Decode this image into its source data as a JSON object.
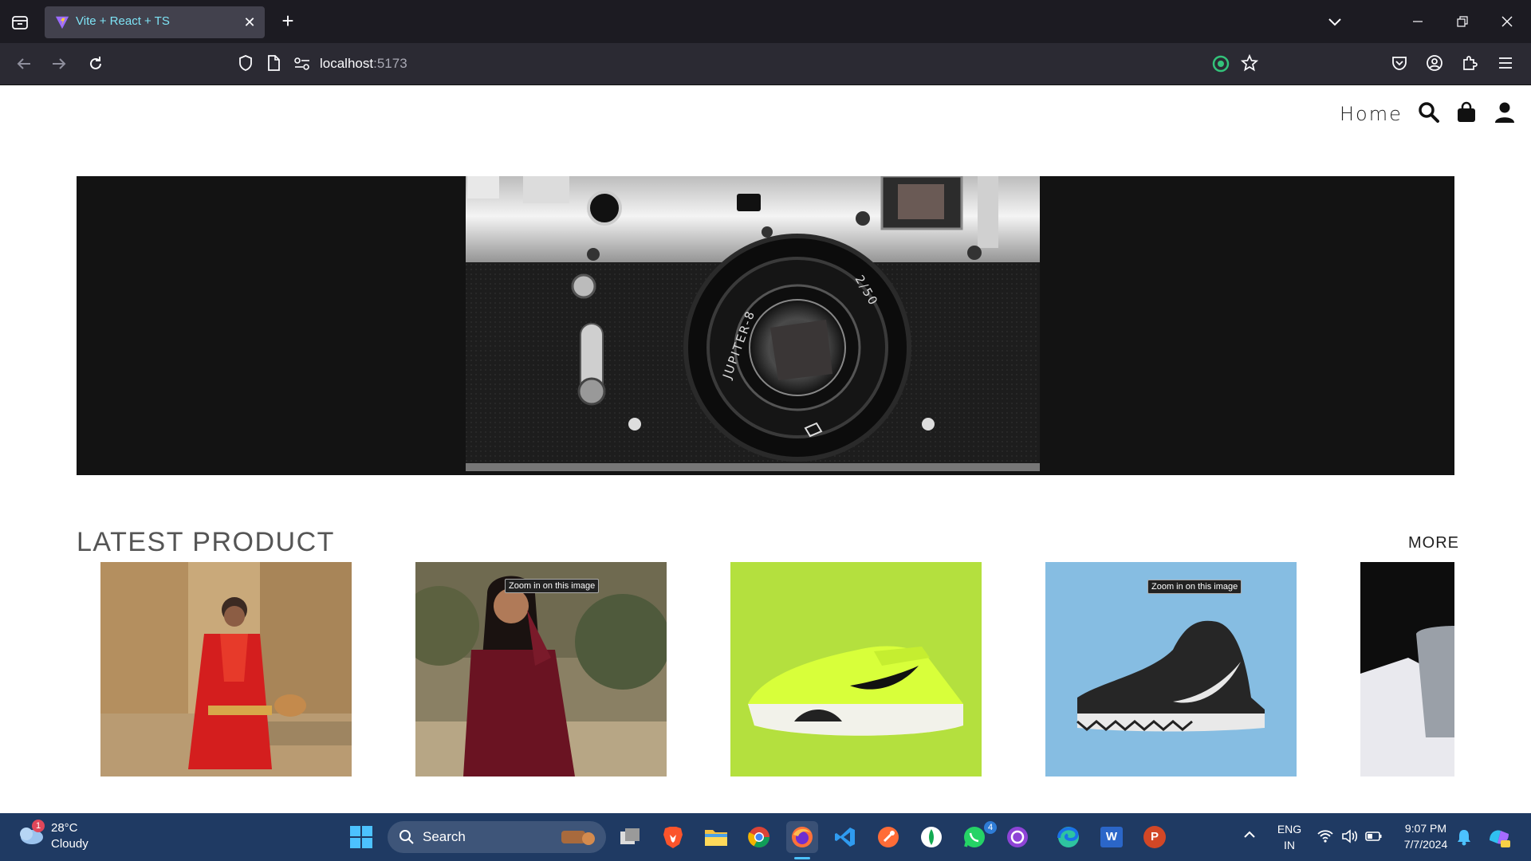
{
  "browser": {
    "tab_title": "Vite + React + TS",
    "url_host": "localhost",
    "url_port": ":5173"
  },
  "site": {
    "nav_home": "Home",
    "section_title": "LATEST PRODUCT",
    "more_label": "MORE",
    "zoom_tooltip": "Zoom in on this image",
    "products": [
      {
        "alt": "Woman in red saree",
        "bg": "#c9a97a"
      },
      {
        "alt": "Woman in maroon kurta",
        "bg": "#8a8064"
      },
      {
        "alt": "Lime green sneaker",
        "bg": "#b4e03e"
      },
      {
        "alt": "Black basketball shoe",
        "bg": "#86bde2"
      },
      {
        "alt": "Laptop box",
        "bg": "#1a1a1a"
      }
    ],
    "hero_text": {
      "lens_left": "JUPITER-8",
      "lens_right": "2/50"
    }
  },
  "taskbar": {
    "weather_temp": "28°C",
    "weather_cond": "Cloudy",
    "weather_badge": "1",
    "search_label": "Search",
    "whatsapp_badge": "4",
    "lang_top": "ENG",
    "lang_bottom": "IN",
    "time": "9:07 PM",
    "date": "7/7/2024",
    "word_letter": "W",
    "ppt_letter": "P"
  },
  "colors": {
    "tab_title": "#7ee3f5",
    "taskbar_bg": "#1f3a63",
    "chrome_bg": "#1c1b22"
  }
}
